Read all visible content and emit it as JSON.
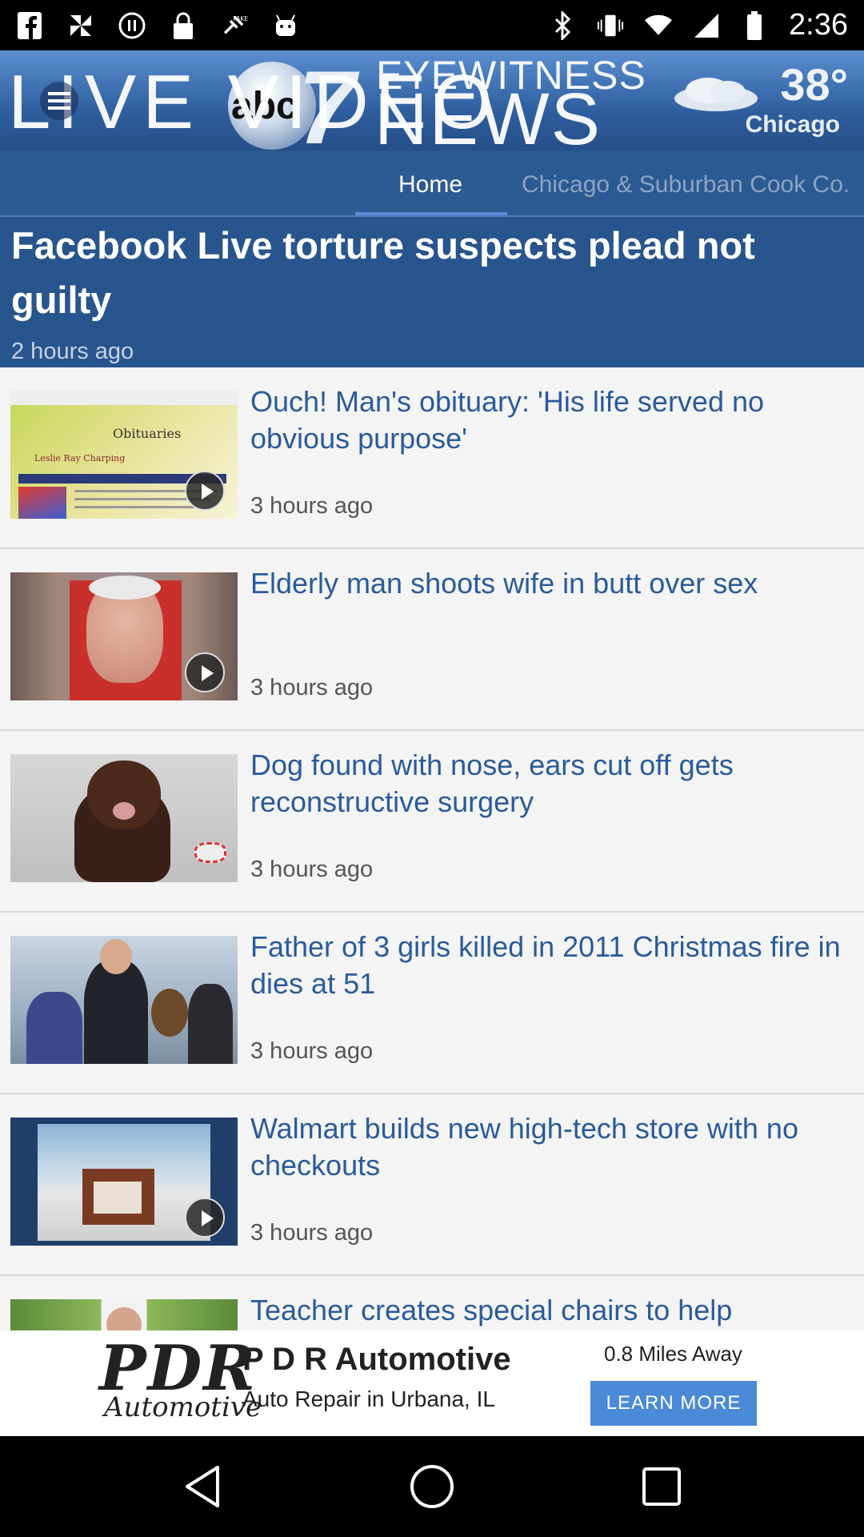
{
  "status_bar": {
    "time": "2:36",
    "left_icons": [
      "facebook-icon",
      "pinwheel-icon",
      "pause-icon",
      "lock-icon",
      "fake-gps-icon",
      "android-icon"
    ],
    "right_icons": [
      "bluetooth-icon",
      "vibrate-icon",
      "wifi-icon",
      "signal-icon",
      "battery-icon"
    ]
  },
  "header": {
    "overlay_text": "LIVE VIDEO",
    "abc_text": "abc",
    "channel_number": "7",
    "brand_top": "EYEWITNESS",
    "brand_bottom": "NEWS",
    "weather": {
      "temperature": "38°",
      "city": "Chicago"
    }
  },
  "tabs": [
    {
      "label": "Home",
      "active": true
    },
    {
      "label": "Chicago & Suburban Cook Co.",
      "active": false
    }
  ],
  "featured": {
    "title": "Facebook Live torture suspects plead not guilty",
    "time": "2 hours ago"
  },
  "articles": [
    {
      "title": "Ouch! Man's obituary: 'His life served no obvious purpose'",
      "time": "3 hours ago",
      "has_video": true,
      "thumb_text": "Obituaries",
      "thumb_sub": "Leslie Ray Charping"
    },
    {
      "title": "Elderly man shoots wife in butt over sex",
      "time": "3 hours ago",
      "has_video": true
    },
    {
      "title": "Dog found with nose, ears cut off gets reconstructive surgery",
      "time": "3 hours ago",
      "has_video": false
    },
    {
      "title": "Father of 3 girls killed in 2011 Christmas fire in dies at 51",
      "time": "3 hours ago",
      "has_video": false
    },
    {
      "title": "Walmart builds new high-tech store with no checkouts",
      "time": "3 hours ago",
      "has_video": true
    },
    {
      "title": "Teacher creates special chairs to help",
      "time": "",
      "has_video": false
    }
  ],
  "ad": {
    "logo_big": "PDR",
    "logo_small": "Automotive",
    "name": "P D R Automotive",
    "subtitle": "Auto Repair in Urbana, IL",
    "distance": "0.8 Miles Away",
    "cta": "LEARN MORE"
  },
  "colors": {
    "header_blue": "#2f5f9f",
    "featured_bg": "#28558d",
    "link_blue": "#2a5b9a",
    "cta_blue": "#4a8ad6"
  }
}
